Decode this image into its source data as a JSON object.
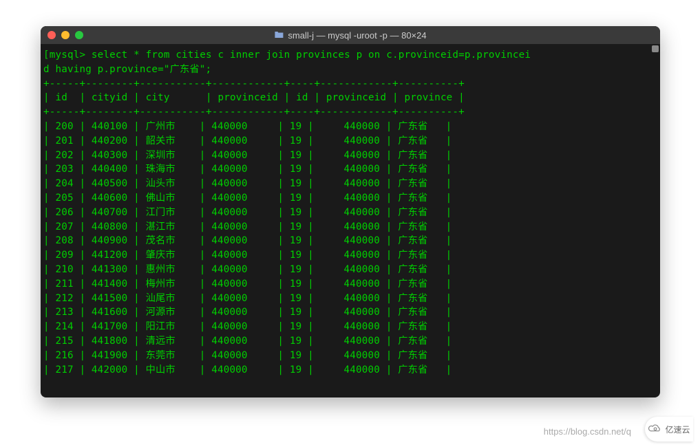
{
  "window": {
    "title": "small-j — mysql -uroot -p — 80×24"
  },
  "terminal": {
    "prompt": "mysql>",
    "query": "select * from cities c inner join provinces p on c.provinceid=p.provincei\nd having p.province=\"广东省\";",
    "divider": "+-----+--------+-----------+------------+----+------------+----------+",
    "header": "| id  | cityid | city      | provinceid | id | provinceid | province |",
    "rows": [
      {
        "id": "200",
        "cityid": "440100",
        "city": "广州市",
        "provinceid": "440000",
        "id2": "19",
        "provinceid2": "440000",
        "province": "广东省"
      },
      {
        "id": "201",
        "cityid": "440200",
        "city": "韶关市",
        "provinceid": "440000",
        "id2": "19",
        "provinceid2": "440000",
        "province": "广东省"
      },
      {
        "id": "202",
        "cityid": "440300",
        "city": "深圳市",
        "provinceid": "440000",
        "id2": "19",
        "provinceid2": "440000",
        "province": "广东省"
      },
      {
        "id": "203",
        "cityid": "440400",
        "city": "珠海市",
        "provinceid": "440000",
        "id2": "19",
        "provinceid2": "440000",
        "province": "广东省"
      },
      {
        "id": "204",
        "cityid": "440500",
        "city": "汕头市",
        "provinceid": "440000",
        "id2": "19",
        "provinceid2": "440000",
        "province": "广东省"
      },
      {
        "id": "205",
        "cityid": "440600",
        "city": "佛山市",
        "provinceid": "440000",
        "id2": "19",
        "provinceid2": "440000",
        "province": "广东省"
      },
      {
        "id": "206",
        "cityid": "440700",
        "city": "江门市",
        "provinceid": "440000",
        "id2": "19",
        "provinceid2": "440000",
        "province": "广东省"
      },
      {
        "id": "207",
        "cityid": "440800",
        "city": "湛江市",
        "provinceid": "440000",
        "id2": "19",
        "provinceid2": "440000",
        "province": "广东省"
      },
      {
        "id": "208",
        "cityid": "440900",
        "city": "茂名市",
        "provinceid": "440000",
        "id2": "19",
        "provinceid2": "440000",
        "province": "广东省"
      },
      {
        "id": "209",
        "cityid": "441200",
        "city": "肇庆市",
        "provinceid": "440000",
        "id2": "19",
        "provinceid2": "440000",
        "province": "广东省"
      },
      {
        "id": "210",
        "cityid": "441300",
        "city": "惠州市",
        "provinceid": "440000",
        "id2": "19",
        "provinceid2": "440000",
        "province": "广东省"
      },
      {
        "id": "211",
        "cityid": "441400",
        "city": "梅州市",
        "provinceid": "440000",
        "id2": "19",
        "provinceid2": "440000",
        "province": "广东省"
      },
      {
        "id": "212",
        "cityid": "441500",
        "city": "汕尾市",
        "provinceid": "440000",
        "id2": "19",
        "provinceid2": "440000",
        "province": "广东省"
      },
      {
        "id": "213",
        "cityid": "441600",
        "city": "河源市",
        "provinceid": "440000",
        "id2": "19",
        "provinceid2": "440000",
        "province": "广东省"
      },
      {
        "id": "214",
        "cityid": "441700",
        "city": "阳江市",
        "provinceid": "440000",
        "id2": "19",
        "provinceid2": "440000",
        "province": "广东省"
      },
      {
        "id": "215",
        "cityid": "441800",
        "city": "清远市",
        "provinceid": "440000",
        "id2": "19",
        "provinceid2": "440000",
        "province": "广东省"
      },
      {
        "id": "216",
        "cityid": "441900",
        "city": "东莞市",
        "provinceid": "440000",
        "id2": "19",
        "provinceid2": "440000",
        "province": "广东省"
      },
      {
        "id": "217",
        "cityid": "442000",
        "city": "中山市",
        "provinceid": "440000",
        "id2": "19",
        "provinceid2": "440000",
        "province": "广东省"
      }
    ]
  },
  "credit": "https://blog.csdn.net/q",
  "watermark": "亿速云"
}
